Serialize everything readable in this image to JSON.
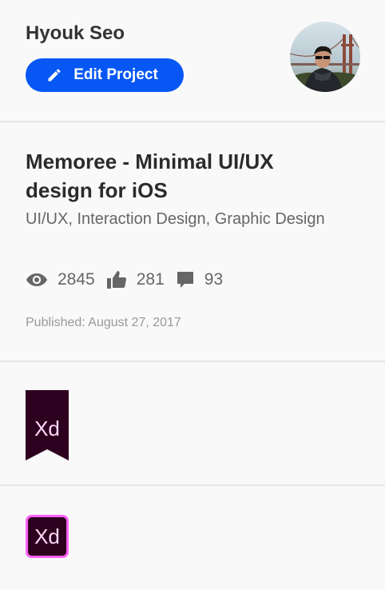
{
  "owner": {
    "name": "Hyouk Seo"
  },
  "actions": {
    "edit_label": "Edit Project"
  },
  "project": {
    "title": "Memoree - Minimal UI/UX design for iOS",
    "fields": "UI/UX, Interaction Design, Graphic Design",
    "stats": {
      "views": "2845",
      "appreciations": "281",
      "comments": "93"
    },
    "published": "Published: August 27, 2017"
  },
  "tools": {
    "ribbon_label": "Xd",
    "badge_label": "Xd"
  },
  "colors": {
    "accent": "#0757f5",
    "xd_dark": "#2e001f",
    "xd_pink": "#ff61f6",
    "xd_text": "#ffd9f9"
  },
  "icons": [
    "pencil-icon",
    "eye-icon",
    "thumbs-up-icon",
    "comment-icon"
  ]
}
